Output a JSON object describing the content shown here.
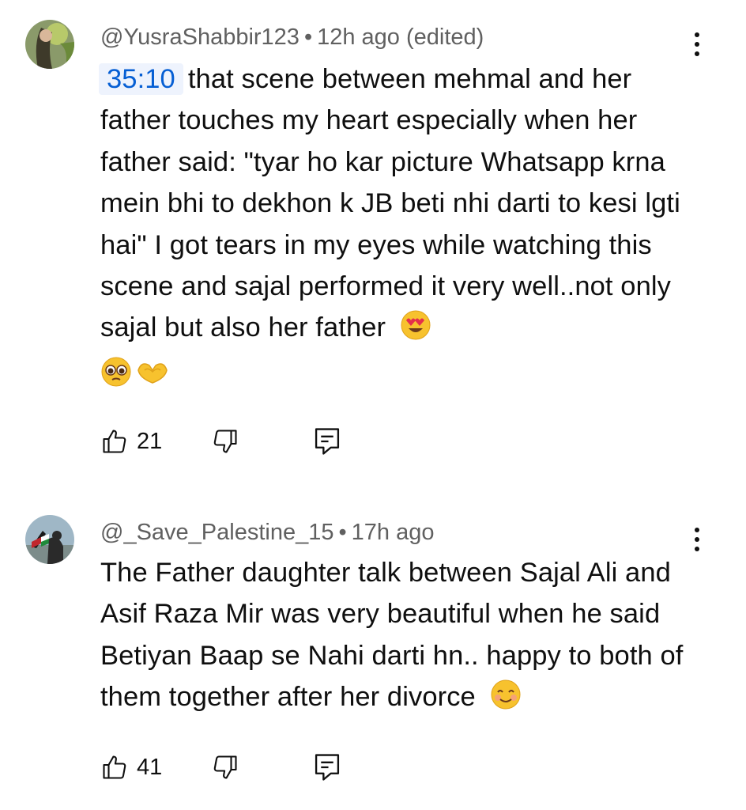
{
  "comments": [
    {
      "author": "@YusraShabbir123",
      "separator": "•",
      "time": "12h ago (edited)",
      "timestamp_link": "35:10",
      "text": "that scene between mehmal and her father touches my heart especially when her father said: \"tyar ho kar picture Whatsapp krna mein bhi to dekhon k JB beti nhi darti to kesi lgti hai\" I got tears in my eyes while watching this scene and sajal performed it very well..not only sajal but also her father",
      "emojis": [
        "heart-eyes-emoji",
        "pleading-face-emoji",
        "heart-hands-emoji"
      ],
      "likes": "21"
    },
    {
      "author": "@_Save_Palestine_15",
      "separator": "•",
      "time": "17h ago",
      "text": "The Father daughter talk between Sajal Ali and Asif Raza Mir was very beautiful when he said Betiyan Baap se Nahi darti hn.. happy to both of them together after her divorce",
      "emojis": [
        "smiling-face-emoji"
      ],
      "likes": "41"
    }
  ],
  "colors": {
    "timestamp_link": "#065fd4",
    "timestamp_bg": "#eef3fd",
    "meta_text": "#606060",
    "body_text": "#0f0f0f"
  },
  "icons": {
    "like": "thumbs-up-icon",
    "dislike": "thumbs-down-icon",
    "reply": "reply-icon",
    "more": "vertical-ellipsis-icon"
  }
}
